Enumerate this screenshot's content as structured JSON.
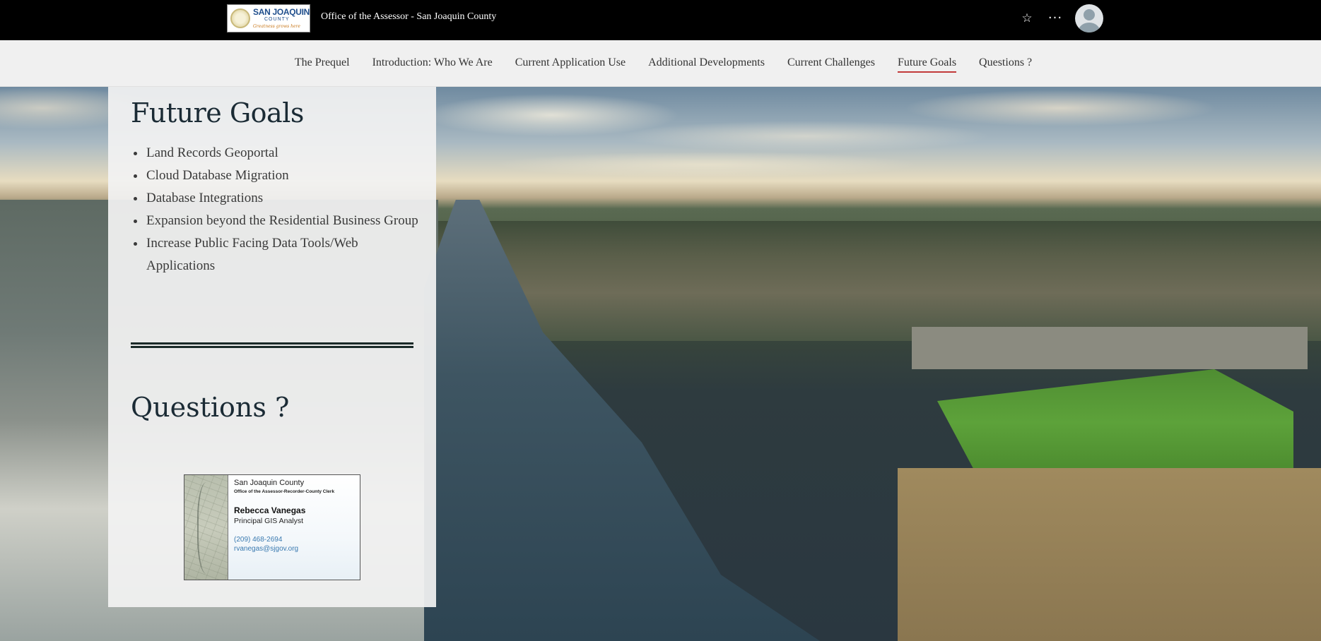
{
  "header": {
    "logo": {
      "line1": "SAN JOAQUIN",
      "line2": "COUNTY",
      "tagline": "Greatness grows here"
    },
    "site_title": "Office of the Assessor - San Joaquin County",
    "actions": {
      "favorite_icon": "star-icon",
      "more_icon": "more-options-icon",
      "favorite_glyph": "☆",
      "more_glyph": "···"
    }
  },
  "nav": {
    "items": [
      {
        "label": "The Prequel",
        "active": false
      },
      {
        "label": "Introduction: Who We Are",
        "active": false
      },
      {
        "label": "Current Application Use",
        "active": false
      },
      {
        "label": "Additional Developments",
        "active": false
      },
      {
        "label": "Current Challenges",
        "active": false
      },
      {
        "label": "Future Goals",
        "active": true
      },
      {
        "label": "Questions ?",
        "active": false
      }
    ],
    "active_underline_color": "#c23a3a"
  },
  "content": {
    "future_goals": {
      "heading": "Future Goals",
      "items": [
        "Land Records Geoportal",
        "Cloud Database Migration",
        "Database Integrations",
        "Expansion beyond the Residential Business Group",
        "Increase Public Facing Data Tools/Web Applications"
      ]
    },
    "questions": {
      "heading": "Questions ?"
    },
    "business_card": {
      "org": "San Joaquin County",
      "department": "Office of the Assessor-Recorder-County Clerk",
      "name": "Rebecca Vanegas",
      "title": "Principal GIS Analyst",
      "phone": "(209) 468-2694",
      "email": "rvanegas@sjgov.org"
    }
  },
  "colors": {
    "header_bg": "#000000",
    "nav_bg": "#f0f0f0",
    "heading": "#1b2b35",
    "link": "#3a7ab0"
  }
}
